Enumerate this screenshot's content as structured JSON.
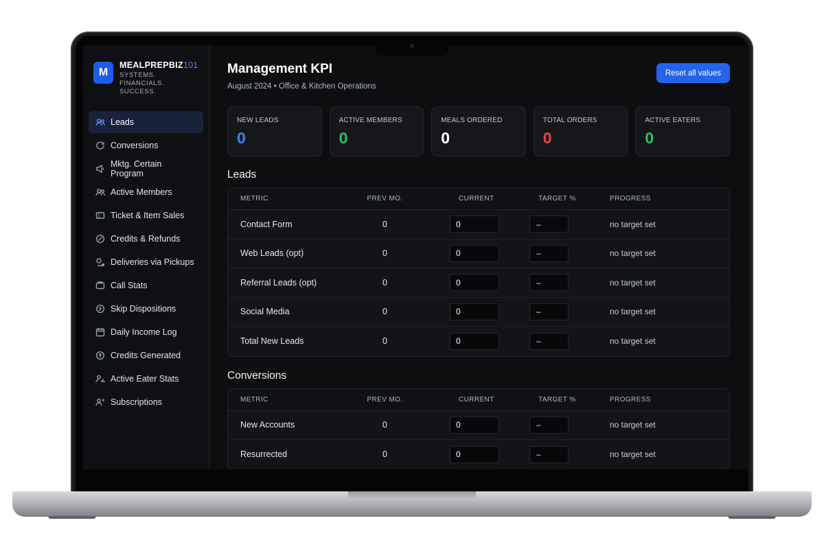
{
  "brand": {
    "logo_letter": "M",
    "name": "MEALPREPBIZ",
    "name_accent": "101",
    "tagline_line1": "SYSTEMS. FINANCIALS.",
    "tagline_line2": "SUCCESS."
  },
  "sidebar": {
    "items": [
      {
        "label": "Leads",
        "icon": "users-icon",
        "active": true
      },
      {
        "label": "Conversions",
        "icon": "refresh-icon"
      },
      {
        "label": "Mktg. Certain Program",
        "icon": "megaphone-icon"
      },
      {
        "label": "Active Members",
        "icon": "users-icon"
      },
      {
        "label": "Ticket & Item Sales",
        "icon": "ticket-icon"
      },
      {
        "label": "Credits & Refunds",
        "icon": "refund-icon"
      },
      {
        "label": "Deliveries via Pickups",
        "icon": "truck-icon"
      },
      {
        "label": "Call Stats",
        "icon": "phone-icon"
      },
      {
        "label": "Skip Dispositions",
        "icon": "skip-icon"
      },
      {
        "label": "Daily Income Log",
        "icon": "calendar-icon"
      },
      {
        "label": "Credits Generated",
        "icon": "coin-icon"
      },
      {
        "label": "Active Eater Stats",
        "icon": "user-stats-icon"
      },
      {
        "label": "Subscriptions",
        "icon": "subscription-icon"
      }
    ]
  },
  "header": {
    "title": "Management KPI",
    "subtitle": "August 2024 • Office & Kitchen Operations",
    "reset_label": "Reset all values"
  },
  "kpis": [
    {
      "label": "NEW LEADS",
      "value": "0",
      "color": "#3b82f6"
    },
    {
      "label": "ACTIVE MEMBERS",
      "value": "0",
      "color": "#22c55e"
    },
    {
      "label": "MEALS ORDERED",
      "value": "0",
      "color": "#ffffff"
    },
    {
      "label": "TOTAL ORDERS",
      "value": "0",
      "color": "#ef4444"
    },
    {
      "label": "ACTIVE EATERS",
      "value": "0",
      "color": "#22c55e"
    }
  ],
  "table_headers": {
    "metric": "METRIC",
    "prev": "PREV MO.",
    "current": "CURRENT",
    "target": "TARGET %",
    "progress": "PROGRESS"
  },
  "sections": [
    {
      "title": "Leads",
      "rows": [
        {
          "metric": "Contact Form",
          "prev": "0",
          "current": "0",
          "target": "–",
          "progress": "no target set"
        },
        {
          "metric": "Web Leads (opt)",
          "prev": "0",
          "current": "0",
          "target": "–",
          "progress": "no target set"
        },
        {
          "metric": "Referral Leads (opt)",
          "prev": "0",
          "current": "0",
          "target": "–",
          "progress": "no target set"
        },
        {
          "metric": "Social Media",
          "prev": "0",
          "current": "0",
          "target": "–",
          "progress": "no target set"
        },
        {
          "metric": "Total New Leads",
          "prev": "0",
          "current": "0",
          "target": "–",
          "progress": "no target set"
        }
      ]
    },
    {
      "title": "Conversions",
      "rows": [
        {
          "metric": "New Accounts",
          "prev": "0",
          "current": "0",
          "target": "–",
          "progress": "no target set"
        },
        {
          "metric": "Resurrected",
          "prev": "0",
          "current": "0",
          "target": "–",
          "progress": "no target set"
        }
      ]
    }
  ]
}
